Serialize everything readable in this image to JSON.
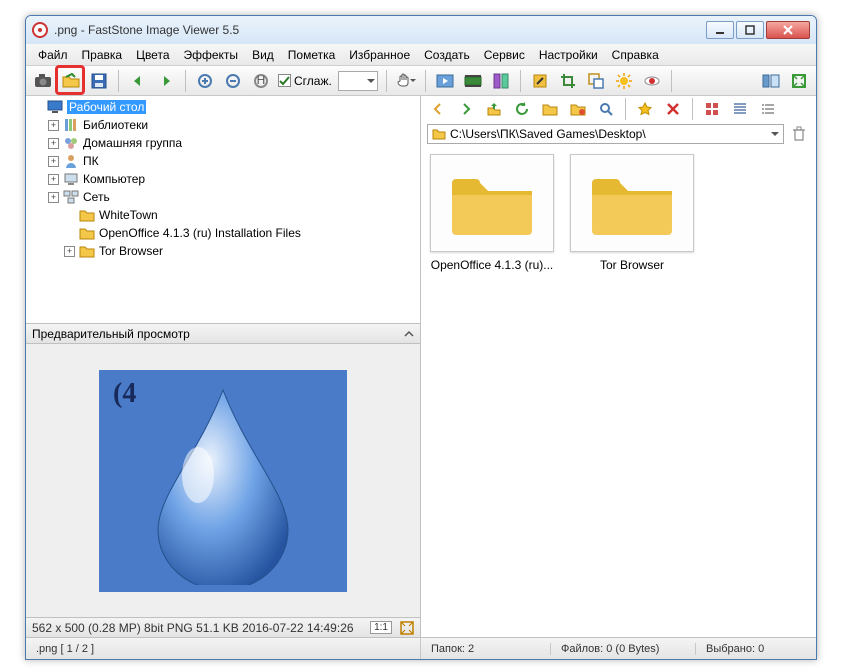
{
  "title": ".png  -  FastStone Image Viewer 5.5",
  "menu": [
    "Файл",
    "Правка",
    "Цвета",
    "Эффекты",
    "Вид",
    "Пометка",
    "Избранное",
    "Создать",
    "Сервис",
    "Настройки",
    "Справка"
  ],
  "toolbar": {
    "smooth_label": "Сглаж."
  },
  "tree": {
    "items": [
      {
        "label": "Рабочий стол",
        "icon": "desktop",
        "selected": true,
        "indent": 0,
        "expand": ""
      },
      {
        "label": "Библиотеки",
        "icon": "libraries",
        "indent": 1,
        "expand": "+"
      },
      {
        "label": "Домашняя группа",
        "icon": "homegroup",
        "indent": 1,
        "expand": "+"
      },
      {
        "label": "ПК",
        "icon": "user",
        "indent": 1,
        "expand": "+"
      },
      {
        "label": "Компьютер",
        "icon": "computer",
        "indent": 1,
        "expand": "+"
      },
      {
        "label": "Сеть",
        "icon": "network",
        "indent": 1,
        "expand": "+"
      },
      {
        "label": "WhiteTown",
        "icon": "folder",
        "indent": 2,
        "expand": ""
      },
      {
        "label": "OpenOffice 4.1.3 (ru) Installation Files",
        "icon": "folder",
        "indent": 2,
        "expand": ""
      },
      {
        "label": "Tor Browser",
        "icon": "folder",
        "indent": 2,
        "expand": "+"
      }
    ]
  },
  "preview": {
    "header": "Предварительный просмотр",
    "mark_text": "(4",
    "info": "562 x 500 (0.28 MP)  8bit  PNG  51.1 KB  2016-07-22 14:49:26",
    "ratio": "1:1"
  },
  "address": {
    "path": "C:\\Users\\ПК\\Saved Games\\Desktop\\"
  },
  "thumbs": [
    {
      "label": "OpenOffice 4.1.3 (ru)..."
    },
    {
      "label": "Tor Browser"
    }
  ],
  "status": {
    "left": ".png [ 1 / 2 ]",
    "folders": "Папок: 2",
    "files": "Файлов: 0 (0 Bytes)",
    "selected": "Выбрано: 0"
  }
}
